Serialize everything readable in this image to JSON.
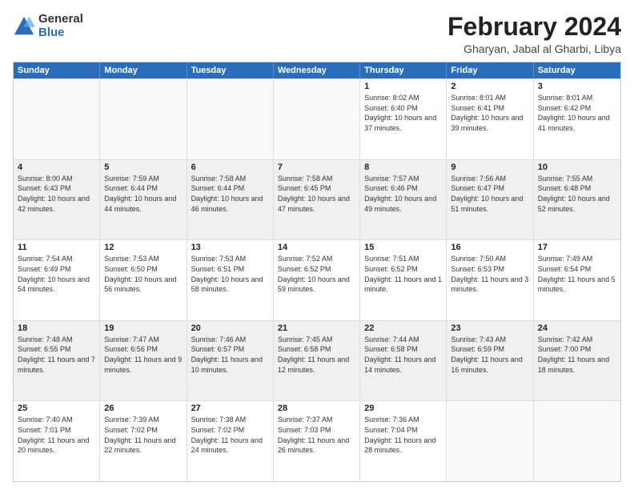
{
  "header": {
    "logo": {
      "general": "General",
      "blue": "Blue"
    },
    "title": "February 2024",
    "subtitle": "Gharyan, Jabal al Gharbi, Libya"
  },
  "calendar": {
    "days_of_week": [
      "Sunday",
      "Monday",
      "Tuesday",
      "Wednesday",
      "Thursday",
      "Friday",
      "Saturday"
    ],
    "rows": [
      [
        {
          "day": "",
          "empty": true
        },
        {
          "day": "",
          "empty": true
        },
        {
          "day": "",
          "empty": true
        },
        {
          "day": "",
          "empty": true
        },
        {
          "day": "1",
          "sunrise": "8:02 AM",
          "sunset": "6:40 PM",
          "daylight": "10 hours and 37 minutes."
        },
        {
          "day": "2",
          "sunrise": "8:01 AM",
          "sunset": "6:41 PM",
          "daylight": "10 hours and 39 minutes."
        },
        {
          "day": "3",
          "sunrise": "8:01 AM",
          "sunset": "6:42 PM",
          "daylight": "10 hours and 41 minutes."
        }
      ],
      [
        {
          "day": "4",
          "sunrise": "8:00 AM",
          "sunset": "6:43 PM",
          "daylight": "10 hours and 42 minutes."
        },
        {
          "day": "5",
          "sunrise": "7:59 AM",
          "sunset": "6:44 PM",
          "daylight": "10 hours and 44 minutes."
        },
        {
          "day": "6",
          "sunrise": "7:58 AM",
          "sunset": "6:44 PM",
          "daylight": "10 hours and 46 minutes."
        },
        {
          "day": "7",
          "sunrise": "7:58 AM",
          "sunset": "6:45 PM",
          "daylight": "10 hours and 47 minutes."
        },
        {
          "day": "8",
          "sunrise": "7:57 AM",
          "sunset": "6:46 PM",
          "daylight": "10 hours and 49 minutes."
        },
        {
          "day": "9",
          "sunrise": "7:56 AM",
          "sunset": "6:47 PM",
          "daylight": "10 hours and 51 minutes."
        },
        {
          "day": "10",
          "sunrise": "7:55 AM",
          "sunset": "6:48 PM",
          "daylight": "10 hours and 52 minutes."
        }
      ],
      [
        {
          "day": "11",
          "sunrise": "7:54 AM",
          "sunset": "6:49 PM",
          "daylight": "10 hours and 54 minutes."
        },
        {
          "day": "12",
          "sunrise": "7:53 AM",
          "sunset": "6:50 PM",
          "daylight": "10 hours and 56 minutes."
        },
        {
          "day": "13",
          "sunrise": "7:53 AM",
          "sunset": "6:51 PM",
          "daylight": "10 hours and 58 minutes."
        },
        {
          "day": "14",
          "sunrise": "7:52 AM",
          "sunset": "6:52 PM",
          "daylight": "10 hours and 59 minutes."
        },
        {
          "day": "15",
          "sunrise": "7:51 AM",
          "sunset": "6:52 PM",
          "daylight": "11 hours and 1 minute."
        },
        {
          "day": "16",
          "sunrise": "7:50 AM",
          "sunset": "6:53 PM",
          "daylight": "11 hours and 3 minutes."
        },
        {
          "day": "17",
          "sunrise": "7:49 AM",
          "sunset": "6:54 PM",
          "daylight": "11 hours and 5 minutes."
        }
      ],
      [
        {
          "day": "18",
          "sunrise": "7:48 AM",
          "sunset": "6:55 PM",
          "daylight": "11 hours and 7 minutes."
        },
        {
          "day": "19",
          "sunrise": "7:47 AM",
          "sunset": "6:56 PM",
          "daylight": "11 hours and 9 minutes."
        },
        {
          "day": "20",
          "sunrise": "7:46 AM",
          "sunset": "6:57 PM",
          "daylight": "11 hours and 10 minutes."
        },
        {
          "day": "21",
          "sunrise": "7:45 AM",
          "sunset": "6:58 PM",
          "daylight": "11 hours and 12 minutes."
        },
        {
          "day": "22",
          "sunrise": "7:44 AM",
          "sunset": "6:58 PM",
          "daylight": "11 hours and 14 minutes."
        },
        {
          "day": "23",
          "sunrise": "7:43 AM",
          "sunset": "6:59 PM",
          "daylight": "11 hours and 16 minutes."
        },
        {
          "day": "24",
          "sunrise": "7:42 AM",
          "sunset": "7:00 PM",
          "daylight": "11 hours and 18 minutes."
        }
      ],
      [
        {
          "day": "25",
          "sunrise": "7:40 AM",
          "sunset": "7:01 PM",
          "daylight": "11 hours and 20 minutes."
        },
        {
          "day": "26",
          "sunrise": "7:39 AM",
          "sunset": "7:02 PM",
          "daylight": "11 hours and 22 minutes."
        },
        {
          "day": "27",
          "sunrise": "7:38 AM",
          "sunset": "7:02 PM",
          "daylight": "11 hours and 24 minutes."
        },
        {
          "day": "28",
          "sunrise": "7:37 AM",
          "sunset": "7:03 PM",
          "daylight": "11 hours and 26 minutes."
        },
        {
          "day": "29",
          "sunrise": "7:36 AM",
          "sunset": "7:04 PM",
          "daylight": "11 hours and 28 minutes."
        },
        {
          "day": "",
          "empty": true
        },
        {
          "day": "",
          "empty": true
        }
      ]
    ]
  }
}
